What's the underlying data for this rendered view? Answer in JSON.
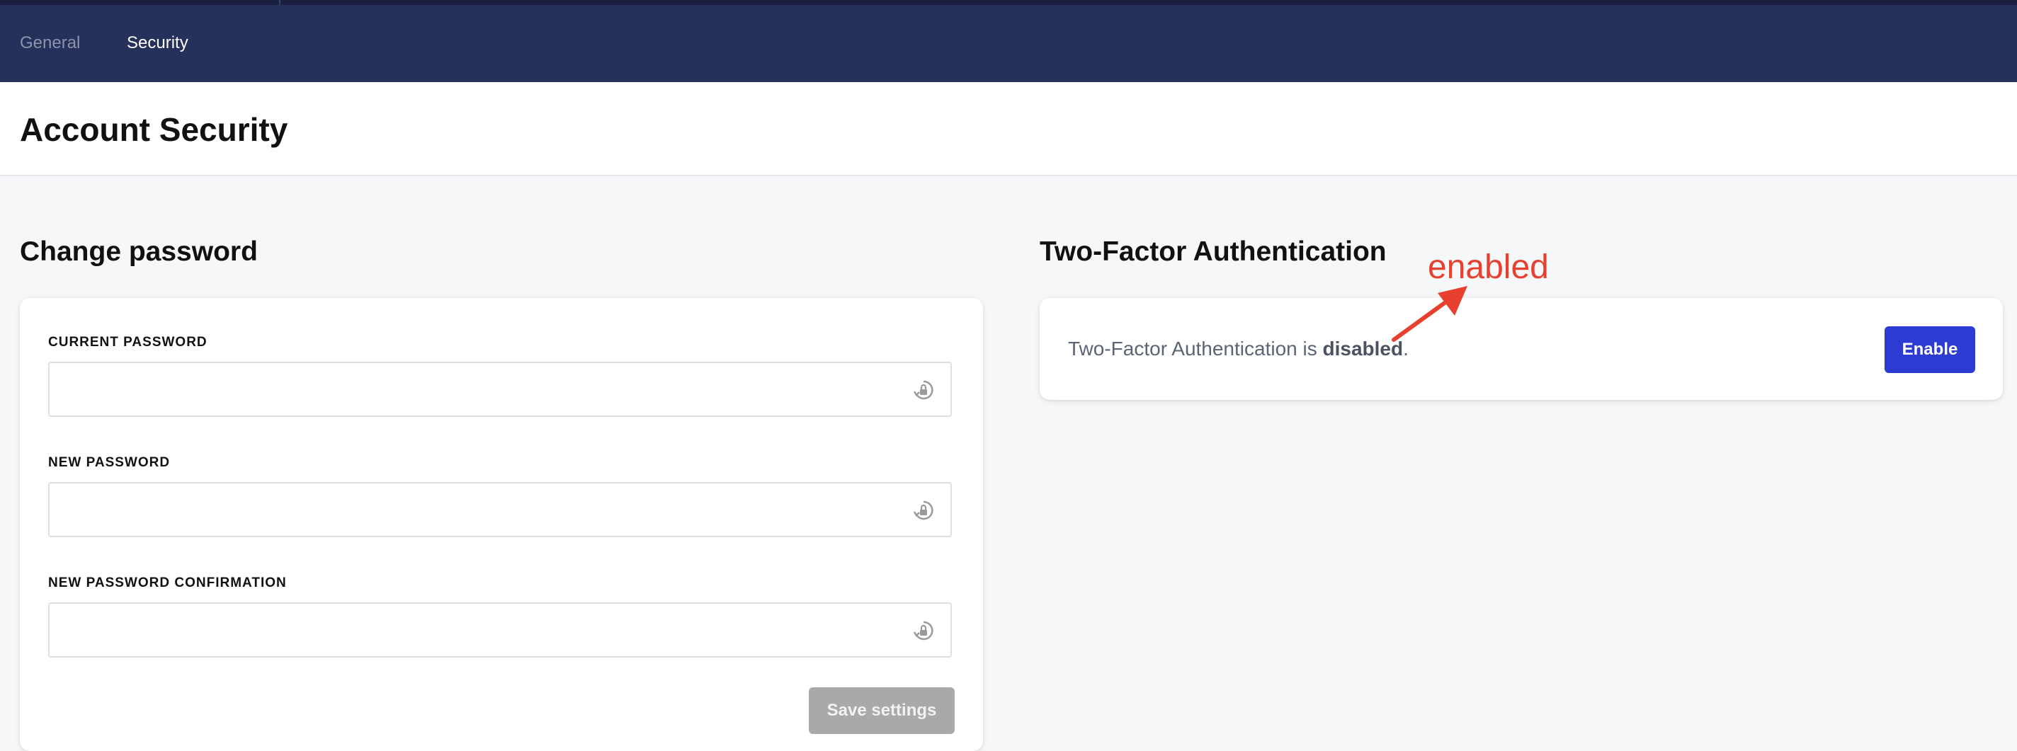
{
  "nav": {
    "tabs": [
      {
        "label": "General",
        "active": false
      },
      {
        "label": "Security",
        "active": true
      }
    ]
  },
  "page": {
    "title": "Account Security"
  },
  "change_password": {
    "title": "Change password",
    "fields": [
      {
        "label": "CURRENT PASSWORD",
        "value": "",
        "icon": "password-key-icon"
      },
      {
        "label": "NEW PASSWORD",
        "value": "",
        "icon": "password-key-icon"
      },
      {
        "label": "NEW PASSWORD CONFIRMATION",
        "value": "",
        "icon": "password-key-icon"
      }
    ],
    "save_label": "Save settings"
  },
  "two_factor": {
    "title": "Two-Factor Authentication",
    "status_prefix": "Two-Factor Authentication is ",
    "status_value": "disabled",
    "status_suffix": ".",
    "enable_label": "Enable"
  },
  "annotation": {
    "text": "enabled"
  },
  "colors": {
    "nav_bg": "#25305b",
    "primary_button": "#2c3bd1",
    "disabled_button": "#a9a9a9",
    "annotation": "#e8402e"
  }
}
